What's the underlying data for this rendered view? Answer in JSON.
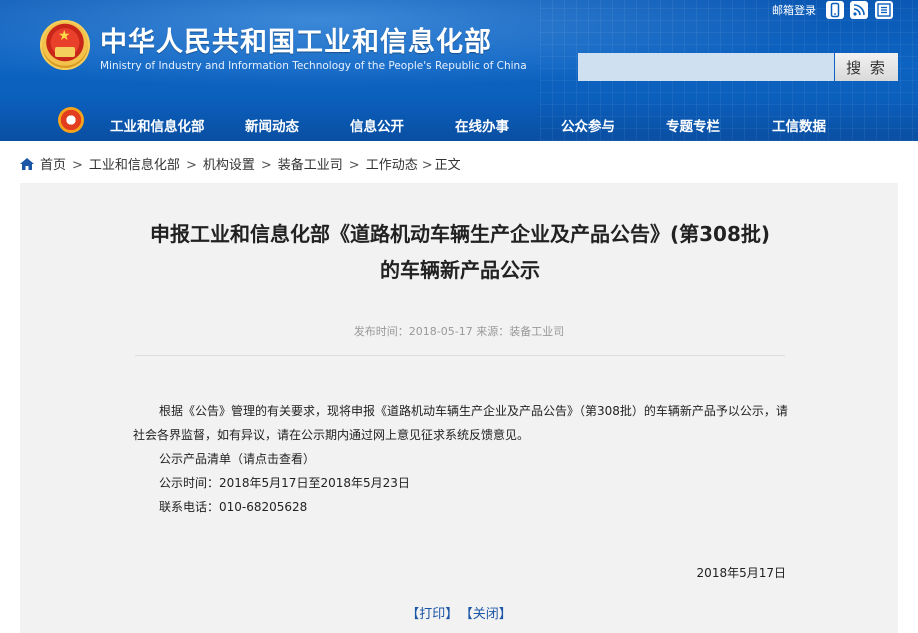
{
  "header": {
    "site_title": "中华人民共和国工业和信息化部",
    "site_title_en": "Ministry of Industry and Information Technology of the People's Republic of China",
    "mail_login": "邮箱登录",
    "search_placeholder": "",
    "search_button": "搜 索",
    "icons": [
      "mobile-icon",
      "rss-icon",
      "article-icon"
    ]
  },
  "nav": {
    "items": [
      "工业和信息化部",
      "新闻动态",
      "信息公开",
      "在线办事",
      "公众参与",
      "专题专栏",
      "工信数据"
    ]
  },
  "breadcrumb": {
    "items": [
      "首页",
      "工业和信息化部",
      "机构设置",
      "装备工业司",
      "工作动态",
      "正文"
    ],
    "separator": ">"
  },
  "article": {
    "title": "申报工业和信息化部《道路机动车辆生产企业及产品公告》(第308批)的车辆新产品公示",
    "meta": "发布时间：2018-05-17 来源：装备工业司",
    "paragraphs": [
      "根据《公告》管理的有关要求，现将申报《道路机动车辆生产企业及产品公告》（第308批）的车辆新产品予以公示，请社会各界监督，如有异议，请在公示期内通过网上意见征求系统反馈意见。",
      "公示产品清单（请点击查看）",
      "公示时间：2018年5月17日至2018年5月23日",
      "联系电话：010-68205628"
    ],
    "date": "2018年5月17日",
    "print_label": "【打印】",
    "close_label": "【关闭】"
  },
  "colors": {
    "header_blue": "#0b5fbd",
    "content_bg": "#f2f2f2",
    "link_blue": "#1a55a6"
  }
}
